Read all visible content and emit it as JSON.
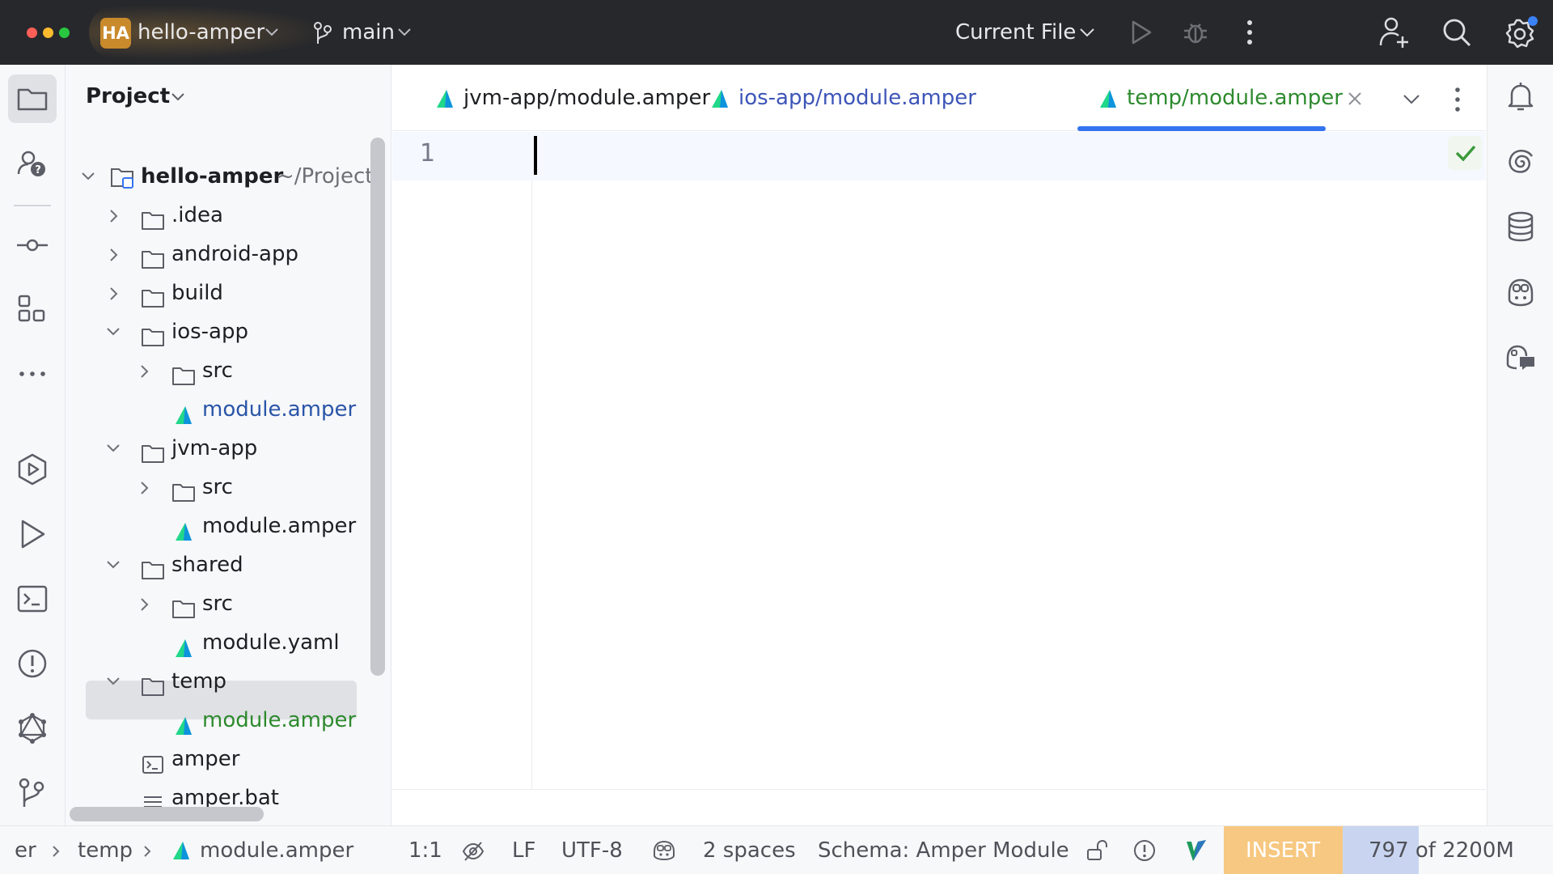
{
  "titlebar": {
    "project_badge": "HA",
    "project_name": "hello-amper",
    "branch": "main",
    "run_config": "Current File"
  },
  "project_panel": {
    "title": "Project",
    "root": {
      "name": "hello-amper",
      "path": "~/Project"
    },
    "tree": [
      {
        "label": ".idea",
        "kind": "folder",
        "depth": 1,
        "expanded": false
      },
      {
        "label": "android-app",
        "kind": "folder",
        "depth": 1,
        "expanded": false
      },
      {
        "label": "build",
        "kind": "folder",
        "depth": 1,
        "expanded": false
      },
      {
        "label": "ios-app",
        "kind": "folder",
        "depth": 1,
        "expanded": true
      },
      {
        "label": "src",
        "kind": "folder",
        "depth": 2,
        "expanded": false
      },
      {
        "label": "module.amper",
        "kind": "amper-file",
        "depth": 2,
        "color": "#2a55a8"
      },
      {
        "label": "jvm-app",
        "kind": "folder",
        "depth": 1,
        "expanded": true
      },
      {
        "label": "src",
        "kind": "folder",
        "depth": 2,
        "expanded": false
      },
      {
        "label": "module.amper",
        "kind": "amper-file",
        "depth": 2
      },
      {
        "label": "shared",
        "kind": "folder",
        "depth": 1,
        "expanded": true
      },
      {
        "label": "src",
        "kind": "folder",
        "depth": 2,
        "expanded": false
      },
      {
        "label": "module.yaml",
        "kind": "amper-file",
        "depth": 2
      },
      {
        "label": "temp",
        "kind": "folder",
        "depth": 1,
        "expanded": true
      },
      {
        "label": "module.amper",
        "kind": "amper-file",
        "depth": 2,
        "selected": true,
        "color": "#2e8a2e"
      },
      {
        "label": "amper",
        "kind": "script-file",
        "depth": 1
      },
      {
        "label": "amper.bat",
        "kind": "text-file",
        "depth": 1
      }
    ]
  },
  "tabs": [
    {
      "label": "jvm-app/module.amper",
      "color": "#1e1f22"
    },
    {
      "label": "ios-app/module.amper",
      "color": "#3d55b8"
    },
    {
      "label": "temp/module.amper",
      "color": "#2e8a2e",
      "active": true
    }
  ],
  "editor": {
    "line_number": "1"
  },
  "statusbar": {
    "breadcrumb_prefix": "er",
    "breadcrumb_folder": "temp",
    "breadcrumb_file": "module.amper",
    "position": "1:1",
    "line_separator": "LF",
    "encoding": "UTF-8",
    "indent": "2 spaces",
    "schema": "Schema: Amper Module",
    "mode": "INSERT",
    "memory": "797 of 2200M",
    "memory_used_fraction": 0.36
  },
  "colors": {
    "accent": "#3574f0",
    "amper_green": "#2e8a2e",
    "insert_bg": "#f7c881"
  }
}
